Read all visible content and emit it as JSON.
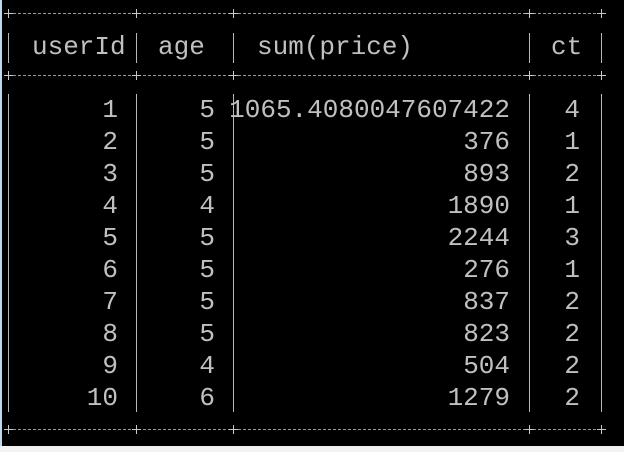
{
  "table": {
    "headers": [
      "userId",
      "age",
      "sum(price)",
      "ct"
    ],
    "rows": [
      [
        "1",
        "5",
        "1065.4080047607422",
        "4"
      ],
      [
        "2",
        "5",
        "376",
        "1"
      ],
      [
        "3",
        "5",
        "893",
        "2"
      ],
      [
        "4",
        "4",
        "1890",
        "1"
      ],
      [
        "5",
        "5",
        "2244",
        "3"
      ],
      [
        "6",
        "5",
        "276",
        "1"
      ],
      [
        "7",
        "5",
        "837",
        "2"
      ],
      [
        "8",
        "5",
        "823",
        "2"
      ],
      [
        "9",
        "4",
        "504",
        "2"
      ],
      [
        "10",
        "6",
        "1279",
        "2"
      ]
    ]
  },
  "colors": {
    "background": "#000000",
    "text": "#c0c0c0"
  }
}
